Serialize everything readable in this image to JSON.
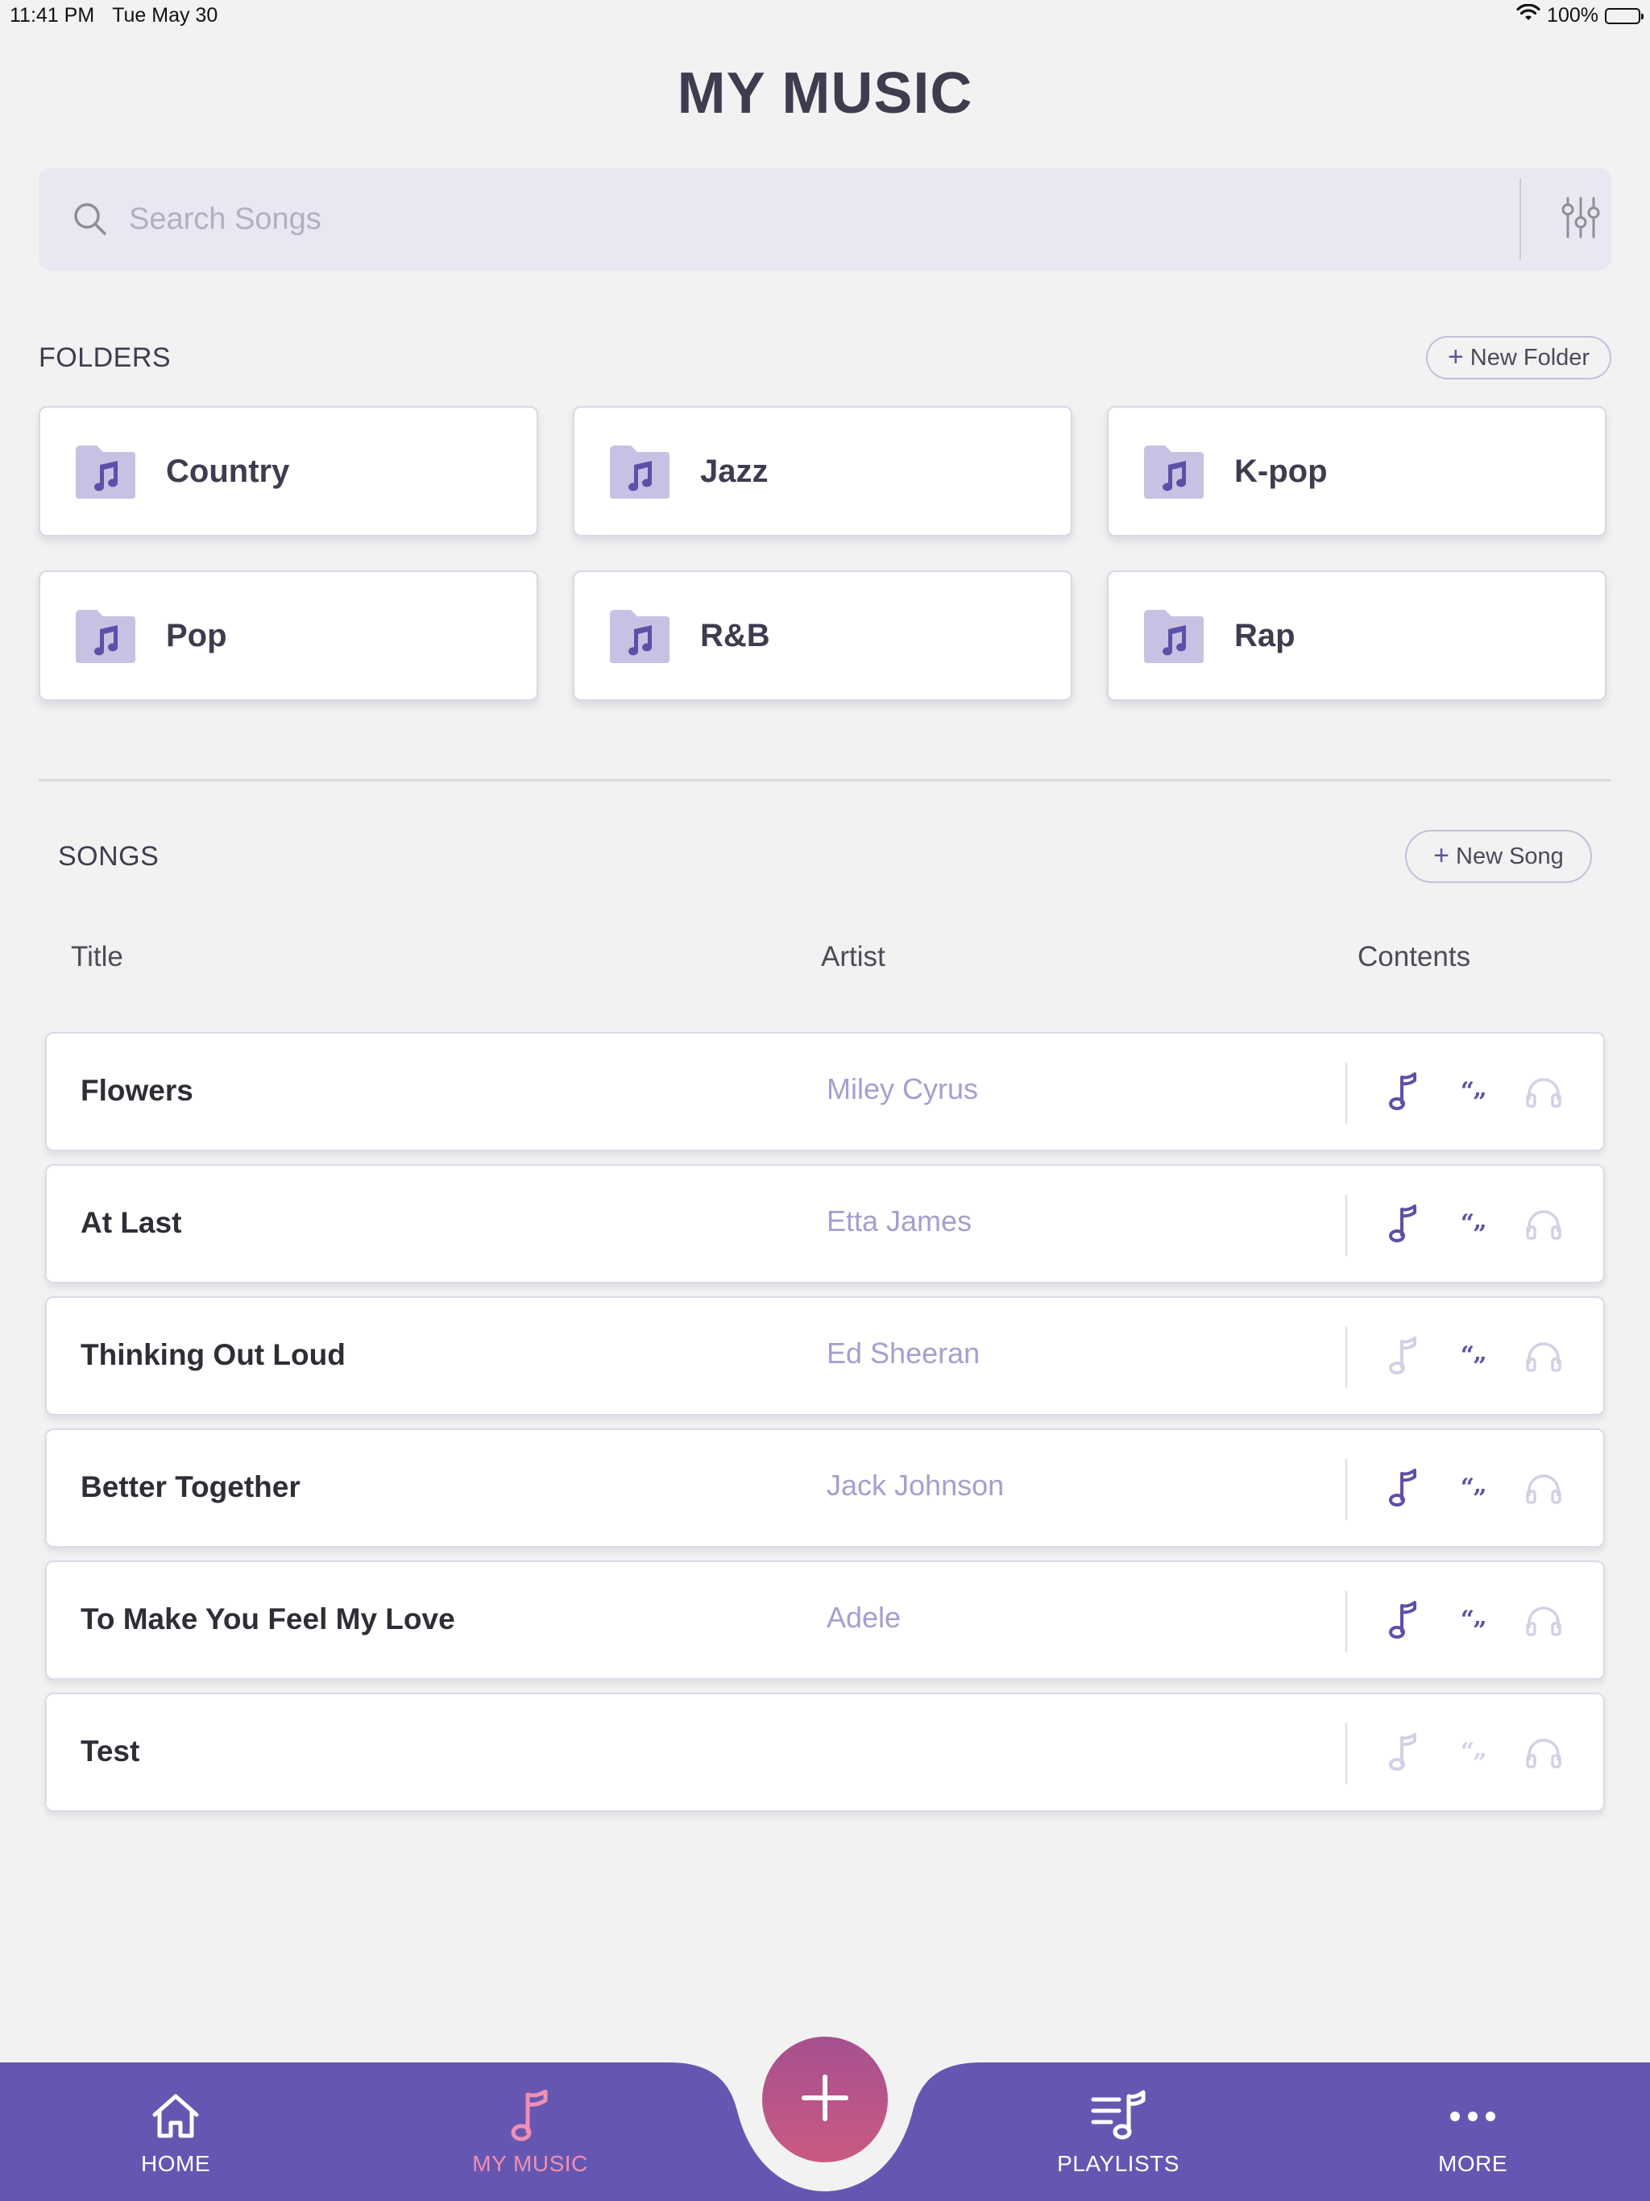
{
  "status_bar": {
    "time": "11:41 PM",
    "date": "Tue May 30",
    "battery": "100%"
  },
  "page": {
    "title": "MY MUSIC"
  },
  "search": {
    "placeholder": "Search Songs"
  },
  "folders": {
    "heading": "FOLDERS",
    "new_label": "New Folder",
    "items": [
      {
        "name": "Country"
      },
      {
        "name": "Jazz"
      },
      {
        "name": "K-pop"
      },
      {
        "name": "Pop"
      },
      {
        "name": "R&B"
      },
      {
        "name": "Rap"
      }
    ]
  },
  "songs": {
    "heading": "SONGS",
    "new_label": "New Song",
    "columns": {
      "title": "Title",
      "artist": "Artist",
      "contents": "Contents"
    },
    "rows": [
      {
        "title": "Flowers",
        "artist": "Miley Cyrus",
        "has_sheet": true,
        "has_lyrics": true,
        "has_audio": false
      },
      {
        "title": "At Last",
        "artist": "Etta James",
        "has_sheet": true,
        "has_lyrics": true,
        "has_audio": false
      },
      {
        "title": "Thinking Out Loud",
        "artist": "Ed Sheeran",
        "has_sheet": false,
        "has_lyrics": true,
        "has_audio": false
      },
      {
        "title": "Better Together",
        "artist": "Jack Johnson",
        "has_sheet": true,
        "has_lyrics": true,
        "has_audio": false
      },
      {
        "title": "To Make You Feel My Love",
        "artist": "Adele",
        "has_sheet": true,
        "has_lyrics": true,
        "has_audio": false
      },
      {
        "title": "Test",
        "artist": "",
        "has_sheet": false,
        "has_lyrics": false,
        "has_audio": false
      }
    ]
  },
  "icons": {
    "search": "search-icon",
    "filter": "sliders-icon",
    "folder": "music-folder-icon",
    "sheet": "music-note-icon",
    "lyrics": "quote-icon",
    "audio": "headphones-icon"
  },
  "nav": {
    "items": [
      {
        "label": "HOME",
        "icon": "home-icon",
        "active": false
      },
      {
        "label": "MY MUSIC",
        "icon": "music-note-icon",
        "active": true
      },
      {
        "label": "PLAYLISTS",
        "icon": "playlist-icon",
        "active": false
      },
      {
        "label": "MORE",
        "icon": "more-icon",
        "active": false
      }
    ],
    "fab_icon": "plus-icon"
  },
  "colors": {
    "accent": "#6557b1",
    "active_nav": "#f08fb3",
    "background": "#f2f2f2",
    "icon_active": "#5b51a8",
    "icon_inactive": "#d3d0e6",
    "artist_text": "#a49fd0"
  }
}
